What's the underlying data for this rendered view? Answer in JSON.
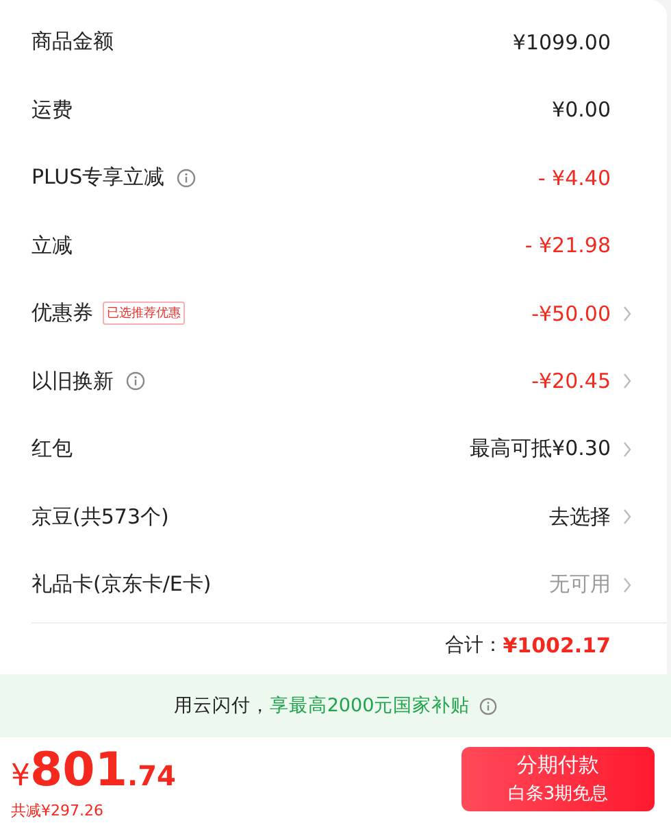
{
  "rows": [
    {
      "label": "商品金额",
      "info": false,
      "value": "¥1099.00",
      "kind": "normal",
      "chevron": false
    },
    {
      "label": "运费",
      "info": false,
      "value": "¥0.00",
      "kind": "normal",
      "chevron": false
    },
    {
      "label": "PLUS专享立减",
      "info": true,
      "value": "- ¥4.40",
      "kind": "discount",
      "chevron": false
    },
    {
      "label": "立减",
      "info": false,
      "value": "- ¥21.98",
      "kind": "discount",
      "chevron": false
    },
    {
      "label": "优惠券",
      "info": false,
      "tag": "已选推荐优惠",
      "value": "-¥50.00",
      "kind": "discount",
      "chevron": true
    },
    {
      "label": "以旧换新",
      "info": true,
      "value": "-¥20.45",
      "kind": "discount",
      "chevron": true
    },
    {
      "label": "红包",
      "info": false,
      "value": "最高可抵¥0.30",
      "kind": "normal",
      "chevron": true
    },
    {
      "label": "京豆(共573个)",
      "info": false,
      "value": "去选择",
      "kind": "normal",
      "chevron": true
    },
    {
      "label": "礼品卡(京东卡/E卡)",
      "info": false,
      "value": "无可用",
      "kind": "muted",
      "chevron": true
    }
  ],
  "total": {
    "label": "合计：",
    "value": "¥1002.17"
  },
  "banner": {
    "lead": "用云闪付，",
    "highlight": "享最高2000元国家补贴"
  },
  "footer": {
    "currency": "¥",
    "price_int": "801",
    "price_dec": ".74",
    "saved": "共减¥297.26",
    "button": {
      "title": "分期付款",
      "subtitle": "白条3期免息"
    }
  }
}
